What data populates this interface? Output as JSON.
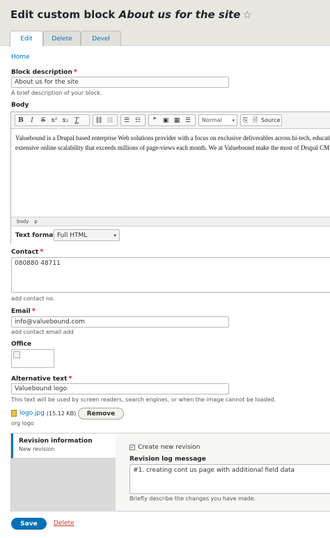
{
  "page": {
    "title_prefix": "Edit custom block",
    "title_entity": "About us for the site",
    "star": "☆"
  },
  "tabs": [
    {
      "label": "Edit",
      "active": true
    },
    {
      "label": "Delete",
      "active": false
    },
    {
      "label": "Devel",
      "active": false
    }
  ],
  "breadcrumb": {
    "home": "Home"
  },
  "block_description": {
    "label": "Block description",
    "required": "*",
    "value": "About us for the site",
    "help": "A brief description of your block."
  },
  "body": {
    "label": "Body",
    "content_line1": "Valuebound is a Drupal based enterprise Web solutions provider with a focus on exclusive deliverables across hi-tech, education, m",
    "content_line2": "extensive online scalability that exceeds millions of page-views each month. We at Valuebound make the most of Drupal CMS by",
    "path_items": [
      "body",
      "p"
    ],
    "format_select": "Normal",
    "source_label": "Source",
    "text_format_label": "Text format",
    "text_format_value": "Full HTML"
  },
  "contact": {
    "label": "Contact",
    "required": "*",
    "value": "080880 48711",
    "help": "add contact no."
  },
  "email": {
    "label": "Email",
    "required": "*",
    "value": "info@valuebound.com",
    "help": "add contact email add"
  },
  "office": {
    "label": "Office"
  },
  "alt_text": {
    "label": "Alternative text",
    "required": "*",
    "value": "Valuebound logo",
    "help": "This text will be used by screen readers, search engines, or when the image cannot be loaded."
  },
  "file": {
    "name": "logo.jpg",
    "size": "(15.12 KB)",
    "remove_label": "Remove",
    "caption": "org logo"
  },
  "revision": {
    "title": "Revision information",
    "subtitle": "New revision",
    "checkbox_label": "Create new revision",
    "log_label": "Revision log message",
    "log_value": "#1. creating cont us page with additional field data",
    "log_help": "Briefly describe the changes you have made."
  },
  "actions": {
    "save_label": "Save",
    "delete_label": "Delete"
  }
}
